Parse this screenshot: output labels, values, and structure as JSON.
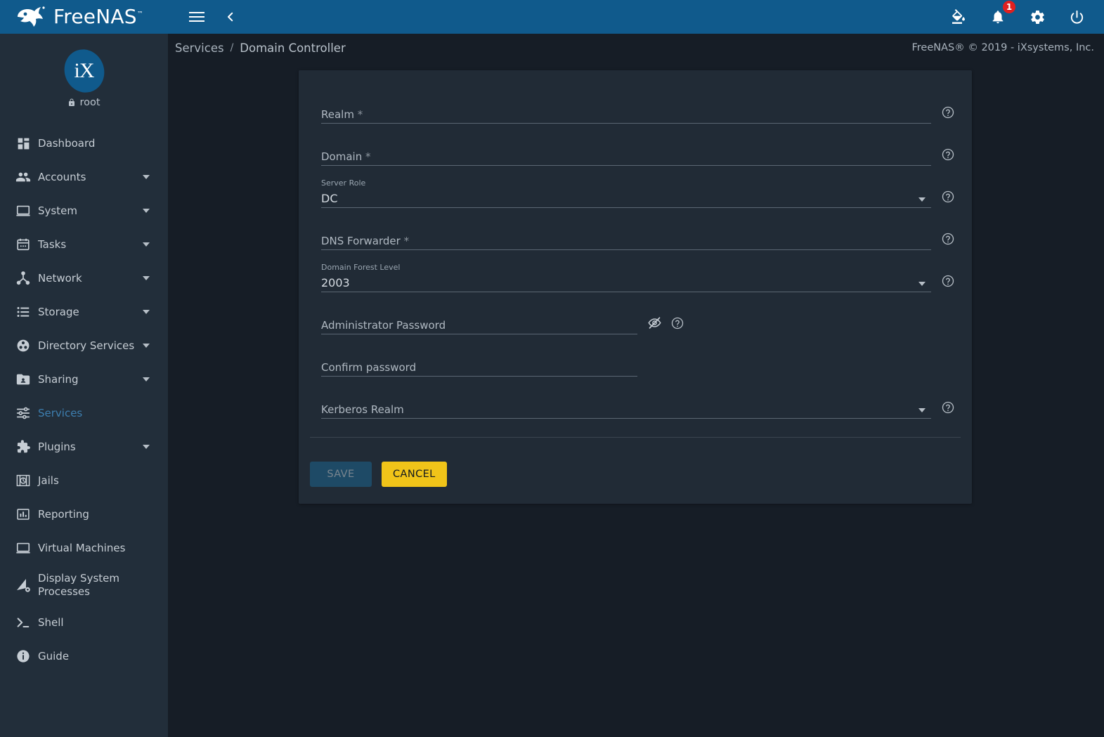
{
  "brand": {
    "name": "FreeNAS",
    "tm": "™"
  },
  "topbar": {
    "menu_icon": "hamburger-icon",
    "back_icon": "chevron-left-icon",
    "theme_icon": "paint-fill-icon",
    "notifications_icon": "bell-icon",
    "notifications_count": "1",
    "settings_icon": "gear-icon",
    "power_icon": "power-icon"
  },
  "sidebar": {
    "avatar_text": "iX",
    "username": "root",
    "lock_icon": "lock-icon",
    "items": [
      {
        "label": "Dashboard",
        "icon": "dashboard-icon",
        "expandable": false,
        "active": false
      },
      {
        "label": "Accounts",
        "icon": "accounts-icon",
        "expandable": true,
        "active": false
      },
      {
        "label": "System",
        "icon": "system-icon",
        "expandable": true,
        "active": false
      },
      {
        "label": "Tasks",
        "icon": "tasks-icon",
        "expandable": true,
        "active": false
      },
      {
        "label": "Network",
        "icon": "network-icon",
        "expandable": true,
        "active": false
      },
      {
        "label": "Storage",
        "icon": "storage-icon",
        "expandable": true,
        "active": false
      },
      {
        "label": "Directory Services",
        "icon": "directory-services-icon",
        "expandable": true,
        "active": false
      },
      {
        "label": "Sharing",
        "icon": "sharing-icon",
        "expandable": true,
        "active": false
      },
      {
        "label": "Services",
        "icon": "services-icon",
        "expandable": false,
        "active": true
      },
      {
        "label": "Plugins",
        "icon": "plugins-icon",
        "expandable": true,
        "active": false
      },
      {
        "label": "Jails",
        "icon": "jails-icon",
        "expandable": false,
        "active": false
      },
      {
        "label": "Reporting",
        "icon": "reporting-icon",
        "expandable": false,
        "active": false
      },
      {
        "label": "Virtual Machines",
        "icon": "virtual-machines-icon",
        "expandable": false,
        "active": false
      },
      {
        "label": "Display System Processes",
        "icon": "display-system-processes-icon",
        "expandable": false,
        "active": false
      },
      {
        "label": "Shell",
        "icon": "shell-icon",
        "expandable": false,
        "active": false
      },
      {
        "label": "Guide",
        "icon": "guide-icon",
        "expandable": false,
        "active": false
      }
    ]
  },
  "breadcrumb": {
    "parent": "Services",
    "separator": "/",
    "current": "Domain Controller"
  },
  "copyright": "FreeNAS® © 2019 - iXsystems, Inc.",
  "form": {
    "fields": [
      {
        "name": "realm",
        "kind": "text",
        "label": "",
        "placeholder": "Realm",
        "required": "*",
        "value": "",
        "help_icon": "help-circle-icon"
      },
      {
        "name": "domain",
        "kind": "text",
        "label": "",
        "placeholder": "Domain",
        "required": "*",
        "value": "",
        "help_icon": "help-circle-icon"
      },
      {
        "name": "server_role",
        "kind": "select",
        "label": "Server Role",
        "placeholder": "",
        "required": "",
        "value": "DC",
        "help_icon": "help-circle-icon"
      },
      {
        "name": "dns_forwarder",
        "kind": "text",
        "label": "",
        "placeholder": "DNS Forwarder",
        "required": "*",
        "value": "",
        "help_icon": "help-circle-icon"
      },
      {
        "name": "domain_forest_level",
        "kind": "select",
        "label": "Domain Forest Level",
        "placeholder": "",
        "required": "",
        "value": "2003",
        "help_icon": "help-circle-icon"
      },
      {
        "name": "administrator_password",
        "kind": "password",
        "label": "",
        "placeholder": "Administrator Password",
        "required": "",
        "value": "",
        "help_icon": "help-circle-icon",
        "reveal_icon": "eye-off-icon"
      },
      {
        "name": "confirm_password",
        "kind": "password",
        "label": "",
        "placeholder": "Confirm password",
        "required": "",
        "value": "",
        "help_icon": "",
        "reveal_icon": ""
      },
      {
        "name": "kerberos_realm",
        "kind": "select",
        "label": "",
        "placeholder": "Kerberos Realm",
        "required": "",
        "value": "",
        "help_icon": "help-circle-icon"
      }
    ],
    "save_label": "SAVE",
    "cancel_label": "CANCEL"
  },
  "colors": {
    "header_blue": "#105a8c",
    "sidebar_bg": "#222e3a",
    "page_bg": "#161d26",
    "card_bg": "#212b36",
    "accent_yellow": "#f0c419",
    "badge_red": "#e02020",
    "active_link": "#3d7fb0"
  }
}
